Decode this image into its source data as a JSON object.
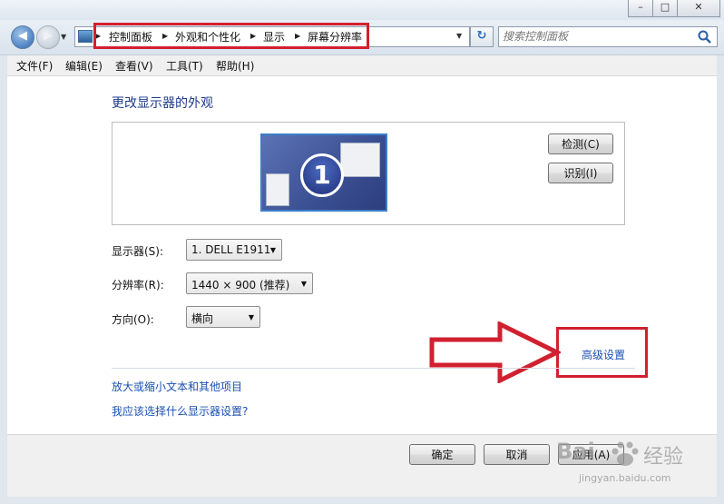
{
  "window": {
    "minimize_glyph": "–",
    "maximize_glyph": "□",
    "close_glyph": "✕"
  },
  "nav": {
    "back_glyph": "◀",
    "forward_glyph": "▶",
    "history_glyph": "▼",
    "refresh_glyph": "↻"
  },
  "breadcrumb": {
    "items": [
      "控制面板",
      "外观和个性化",
      "显示",
      "屏幕分辨率"
    ],
    "separator": "▶",
    "dropdown_glyph": "▼"
  },
  "search": {
    "placeholder": "搜索控制面板"
  },
  "menu": {
    "items": [
      "文件(F)",
      "编辑(E)",
      "查看(V)",
      "工具(T)",
      "帮助(H)"
    ]
  },
  "main": {
    "heading": "更改显示器的外观",
    "monitor_number": "1",
    "detect_label": "检测(C)",
    "identify_label": "识别(I)",
    "display_label": "显示器(S):",
    "display_value": "1. DELL E1911",
    "resolution_label": "分辨率(R):",
    "resolution_value": "1440 × 900 (推荐)",
    "orientation_label": "方向(O):",
    "orientation_value": "横向",
    "advanced_link": "高级设置",
    "link_text_size": "放大或缩小文本和其他项目",
    "link_which_settings": "我应该选择什么显示器设置?"
  },
  "footer": {
    "ok_label": "确定",
    "cancel_label": "取消",
    "apply_label": "应用(A)"
  },
  "watermark": {
    "brand": "Bai",
    "text": "经验",
    "url": "jingyan.baidu.com"
  },
  "colors": {
    "highlight": "#d1202f",
    "link": "#1b4fb0",
    "heading": "#1e3a8a"
  }
}
